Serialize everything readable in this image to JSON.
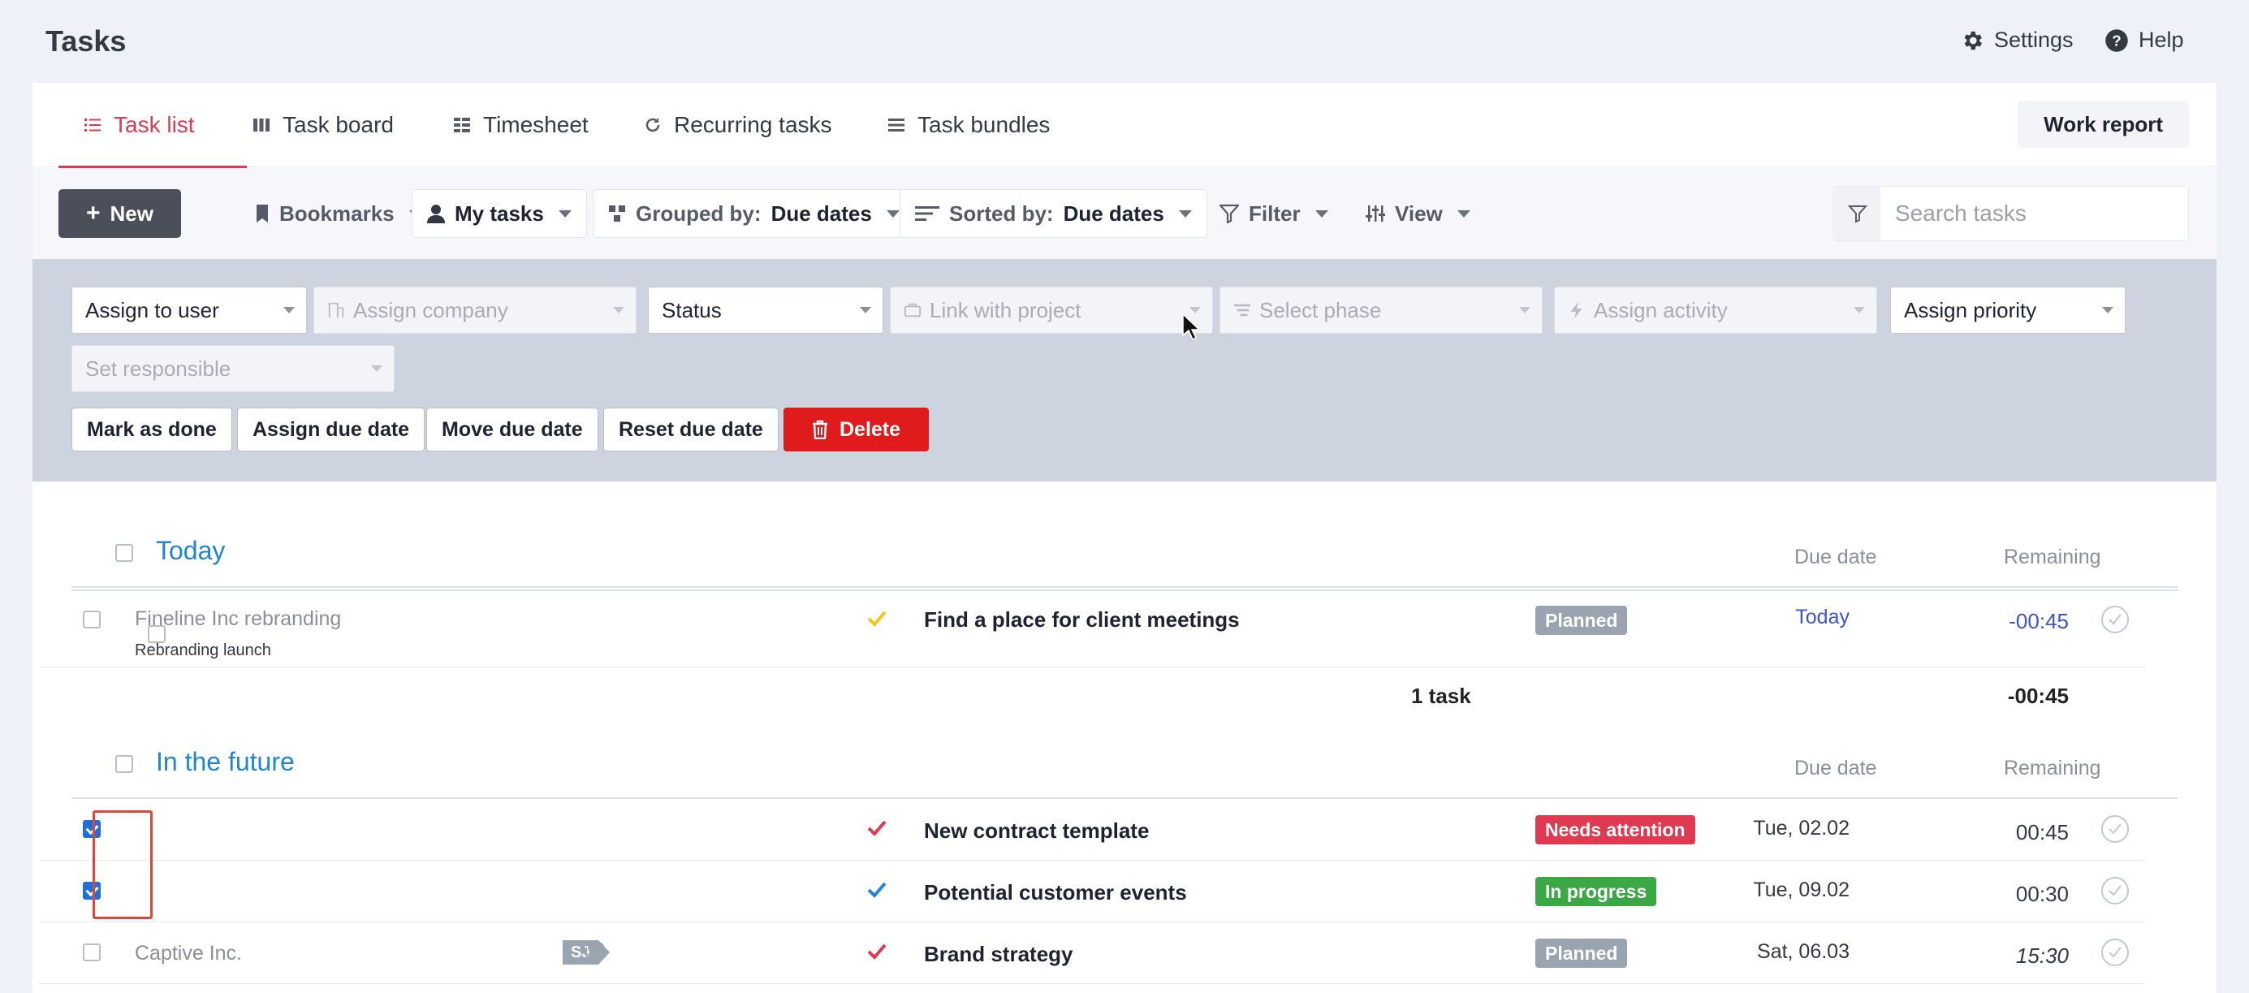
{
  "page": {
    "title": "Tasks",
    "settings_label": "Settings",
    "help_label": "Help"
  },
  "tabs": [
    {
      "label": "Task list",
      "icon": "list-icon",
      "active": true
    },
    {
      "label": "Task board",
      "icon": "board-icon"
    },
    {
      "label": "Timesheet",
      "icon": "timesheet-icon"
    },
    {
      "label": "Recurring tasks",
      "icon": "recurring-icon"
    },
    {
      "label": "Task bundles",
      "icon": "bundle-icon"
    }
  ],
  "work_report_label": "Work report",
  "toolbar": {
    "new_label": "New",
    "bookmarks_label": "Bookmarks",
    "my_tasks_label": "My tasks",
    "grouped_prefix": "Grouped by:",
    "grouped_value": "Due dates",
    "sorted_prefix": "Sorted by:",
    "sorted_value": "Due dates",
    "filter_label": "Filter",
    "view_label": "View",
    "search_placeholder": "Search tasks"
  },
  "bulk_edit": {
    "selects": {
      "assign_user": "Assign to user",
      "assign_company": "Assign company",
      "status": "Status",
      "link_project": "Link with project",
      "select_phase": "Select phase",
      "assign_activity": "Assign activity",
      "assign_priority": "Assign priority",
      "set_responsible": "Set responsible"
    },
    "actions": {
      "mark_done": "Mark as done",
      "assign_due": "Assign due date",
      "move_due": "Move due date",
      "reset_due": "Reset due date",
      "delete": "Delete"
    }
  },
  "columns": {
    "due_date": "Due date",
    "remaining": "Remaining"
  },
  "groups": {
    "today": {
      "title": "Today",
      "rows": [
        {
          "project": "Fineline Inc rebranding",
          "phase": "Rebranding launch",
          "check_color": "#f5c518",
          "task": "Find a place for client meetings",
          "status": "Planned",
          "status_color": "#9aa3b0",
          "due": "Today",
          "remaining": "-00:45",
          "checked": false
        }
      ],
      "summary_count": "1 task",
      "summary_remaining": "-00:45"
    },
    "future": {
      "title": "In the future",
      "rows": [
        {
          "project": "",
          "check_color": "#e03a52",
          "task": "New contract template",
          "status": "Needs attention",
          "status_color": "#e03a52",
          "due": "Tue, 02.02",
          "remaining": "00:45",
          "checked": true
        },
        {
          "project": "",
          "check_color": "#1f86d6",
          "task": "Potential customer events",
          "status": "In progress",
          "status_color": "#3aa945",
          "due": "Tue, 09.02",
          "remaining": "00:30",
          "checked": true
        },
        {
          "project": "Captive Inc.",
          "initials": "SJ",
          "check_color": "#e03a52",
          "task": "Brand strategy",
          "status": "Planned",
          "status_color": "#9aa3b0",
          "due": "Sat, 06.03",
          "remaining": "15:30",
          "checked": false
        }
      ]
    }
  }
}
